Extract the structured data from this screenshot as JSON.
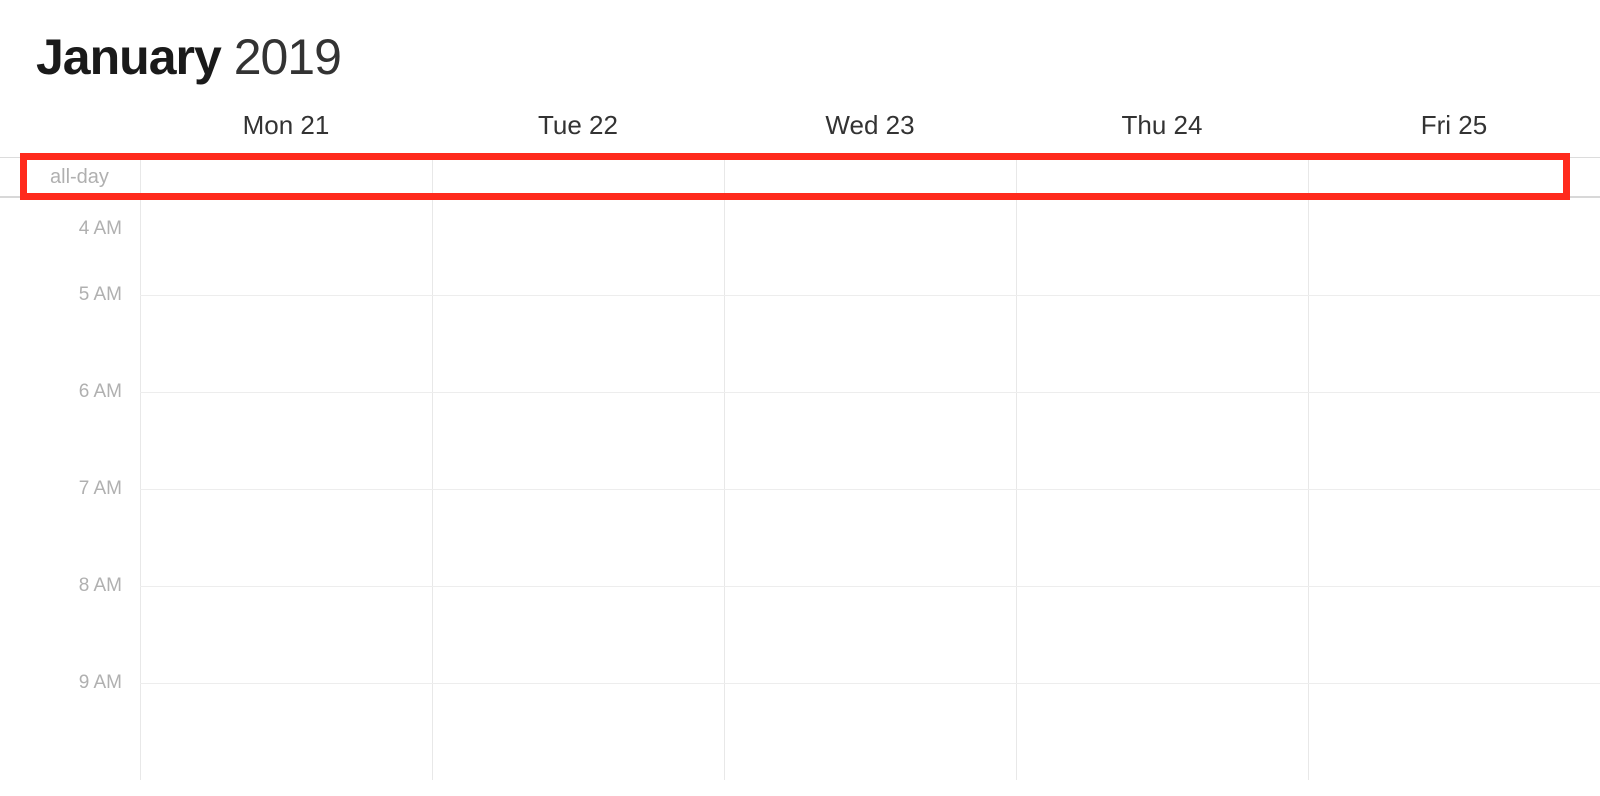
{
  "header": {
    "month": "January",
    "year": "2019"
  },
  "days": [
    {
      "label": "Mon 21"
    },
    {
      "label": "Tue 22"
    },
    {
      "label": "Wed 23"
    },
    {
      "label": "Thu 24"
    },
    {
      "label": "Fri 25"
    }
  ],
  "allDayLabel": "all-day",
  "hours": [
    {
      "label": "4 AM"
    },
    {
      "label": "5 AM"
    },
    {
      "label": "6 AM"
    },
    {
      "label": "7 AM"
    },
    {
      "label": "8 AM"
    },
    {
      "label": "9 AM"
    }
  ]
}
